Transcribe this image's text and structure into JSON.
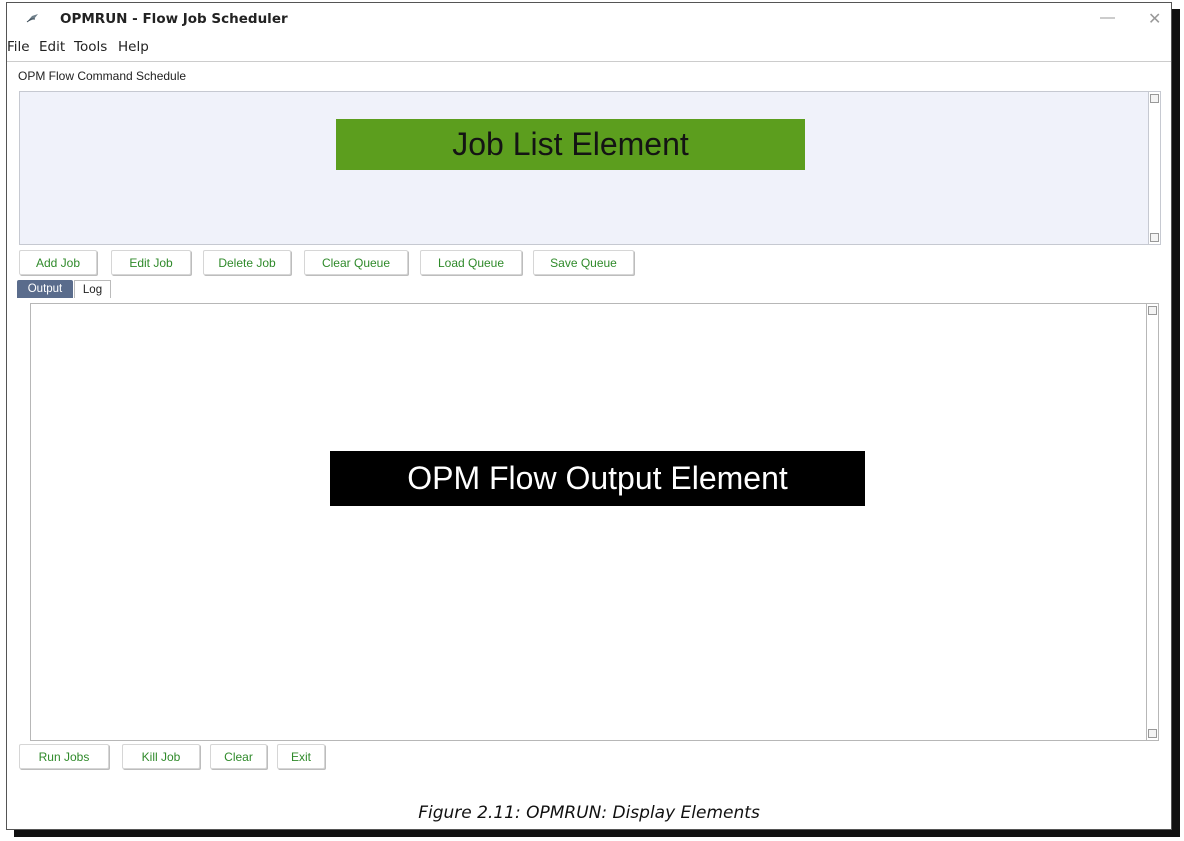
{
  "window": {
    "title": "OPMRUN - Flow Job Scheduler",
    "minimize_glyph": "—",
    "close_glyph": "✕"
  },
  "menu": {
    "items": [
      "File",
      "Edit",
      "Tools",
      "Help"
    ]
  },
  "job_list": {
    "section_label": "OPM Flow Command Schedule",
    "banner_text": "Job List Element",
    "banner_color": "#5c9e1e",
    "buttons": [
      "Add Job",
      "Edit Job",
      "Delete Job",
      "Clear Queue",
      "Load Queue",
      "Save Queue"
    ]
  },
  "tabs": {
    "items": [
      "Output",
      "Log"
    ],
    "selected": "Output"
  },
  "output": {
    "banner_text": "OPM Flow Output Element",
    "banner_color": "#000000"
  },
  "bottom_buttons": [
    "Run Jobs",
    "Kill Job",
    "Clear",
    "Exit"
  ],
  "accent": {
    "button_text_color": "#2f8a2a",
    "selected_tab_color": "#5a6c8c"
  },
  "icons": {
    "app": "app-logo-icon",
    "scroll_up": "scroll-up-arrow-icon",
    "scroll_down": "scroll-down-arrow-icon"
  },
  "caption": "Figure 2.11: OPMRUN: Display Elements"
}
